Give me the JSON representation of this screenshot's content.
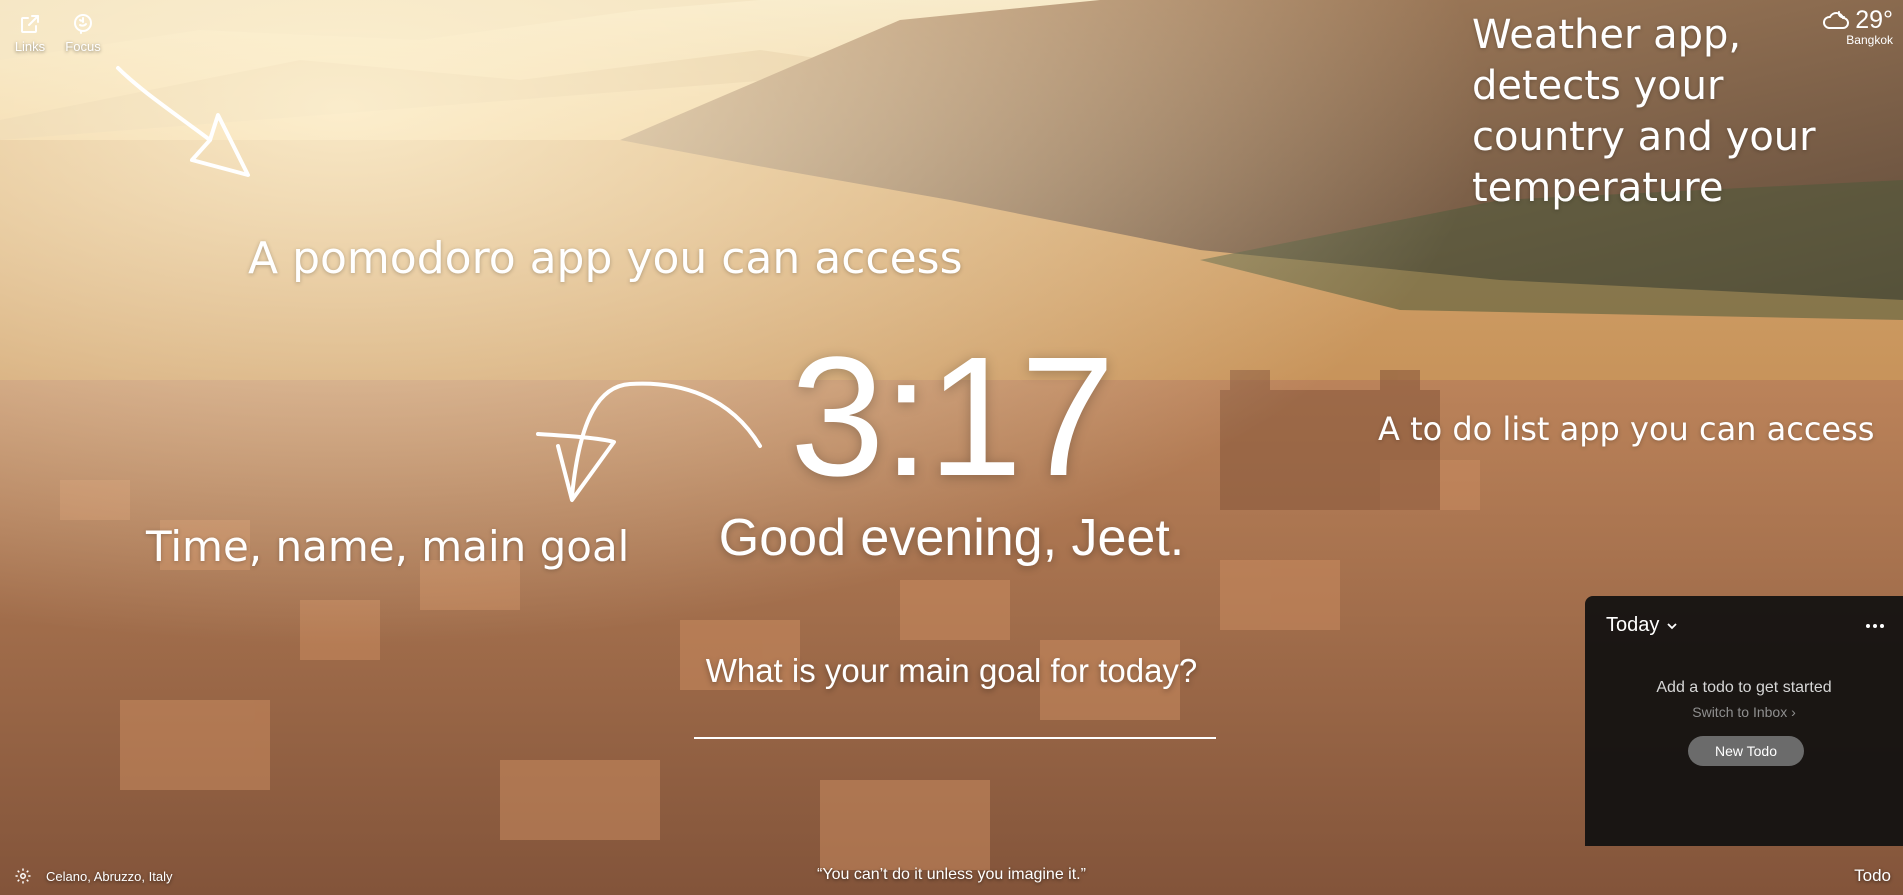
{
  "top_left": {
    "links_label": "Links",
    "focus_label": "Focus"
  },
  "weather": {
    "temperature": "29°",
    "location": "Bangkok"
  },
  "annotations": {
    "weather": [
      "Weather app,",
      "detects your",
      "country and your",
      "temperature"
    ],
    "pomodoro": "A pomodoro app you can access",
    "todo": "A to do list app you can access",
    "time": "Time, name, main goal"
  },
  "main": {
    "time": "3:17",
    "greeting": "Good evening, Jeet.",
    "goal_prompt": "What is your main goal for today?"
  },
  "todo": {
    "header": "Today",
    "empty_text": "Add a todo to get started",
    "switch_link": "Switch to Inbox",
    "new_button": "New Todo",
    "toggle_label": "Todo"
  },
  "footer": {
    "photo_location": "Celano, Abruzzo, Italy",
    "quote": "“You can’t do it unless you imagine it.”"
  },
  "colors": {
    "sky": "#f2dcae",
    "mountain": "#8c6a4e",
    "valley": "#c9955a",
    "town": "#a36a45",
    "panel": "#0f0f0f",
    "button": "#6b6b6b"
  }
}
